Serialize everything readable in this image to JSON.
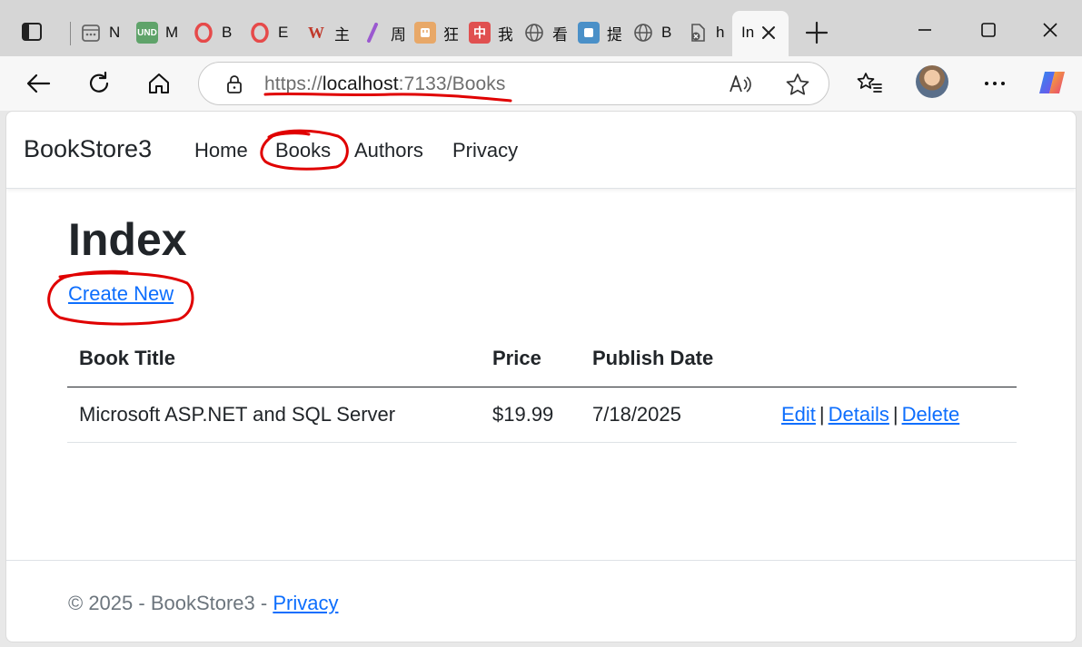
{
  "browser": {
    "tabs": [
      {
        "title": "N",
        "icon": "calendar-icon"
      },
      {
        "title": "M",
        "icon": "und-icon",
        "badge": "UND"
      },
      {
        "title": "B",
        "icon": "opera-icon"
      },
      {
        "title": "E",
        "icon": "opera-icon"
      },
      {
        "title": "主",
        "icon": "w-icon",
        "badge": "W"
      },
      {
        "title": "周",
        "icon": "pen-icon"
      },
      {
        "title": "狂",
        "icon": "plug-icon"
      },
      {
        "title": "我",
        "icon": "zhong-icon",
        "badge": "中"
      },
      {
        "title": "看",
        "icon": "globe-icon"
      },
      {
        "title": "提",
        "icon": "page-icon"
      },
      {
        "title": "B",
        "icon": "globe-icon"
      },
      {
        "title": "h",
        "icon": "broken-page-icon"
      }
    ],
    "active_tab": {
      "title": "In"
    },
    "address": {
      "scheme": "https://",
      "host": "localhost",
      "rest": ":7133/Books"
    }
  },
  "site": {
    "brand": "BookStore3",
    "nav": [
      "Home",
      "Books",
      "Authors",
      "Privacy"
    ],
    "page_title": "Index",
    "create_link": "Create New",
    "table": {
      "headers": [
        "Book Title",
        "Price",
        "Publish Date"
      ],
      "rows": [
        {
          "title": "Microsoft ASP.NET and SQL Server",
          "price": "$19.99",
          "date": "7/18/2025",
          "actions": [
            "Edit",
            "Details",
            "Delete"
          ]
        }
      ],
      "separator": "|"
    },
    "footer": {
      "text": "© 2025 - BookStore3 - ",
      "link": "Privacy"
    }
  },
  "colors": {
    "link": "#0d6efd",
    "annotation": "#e00000",
    "text": "#212529"
  }
}
